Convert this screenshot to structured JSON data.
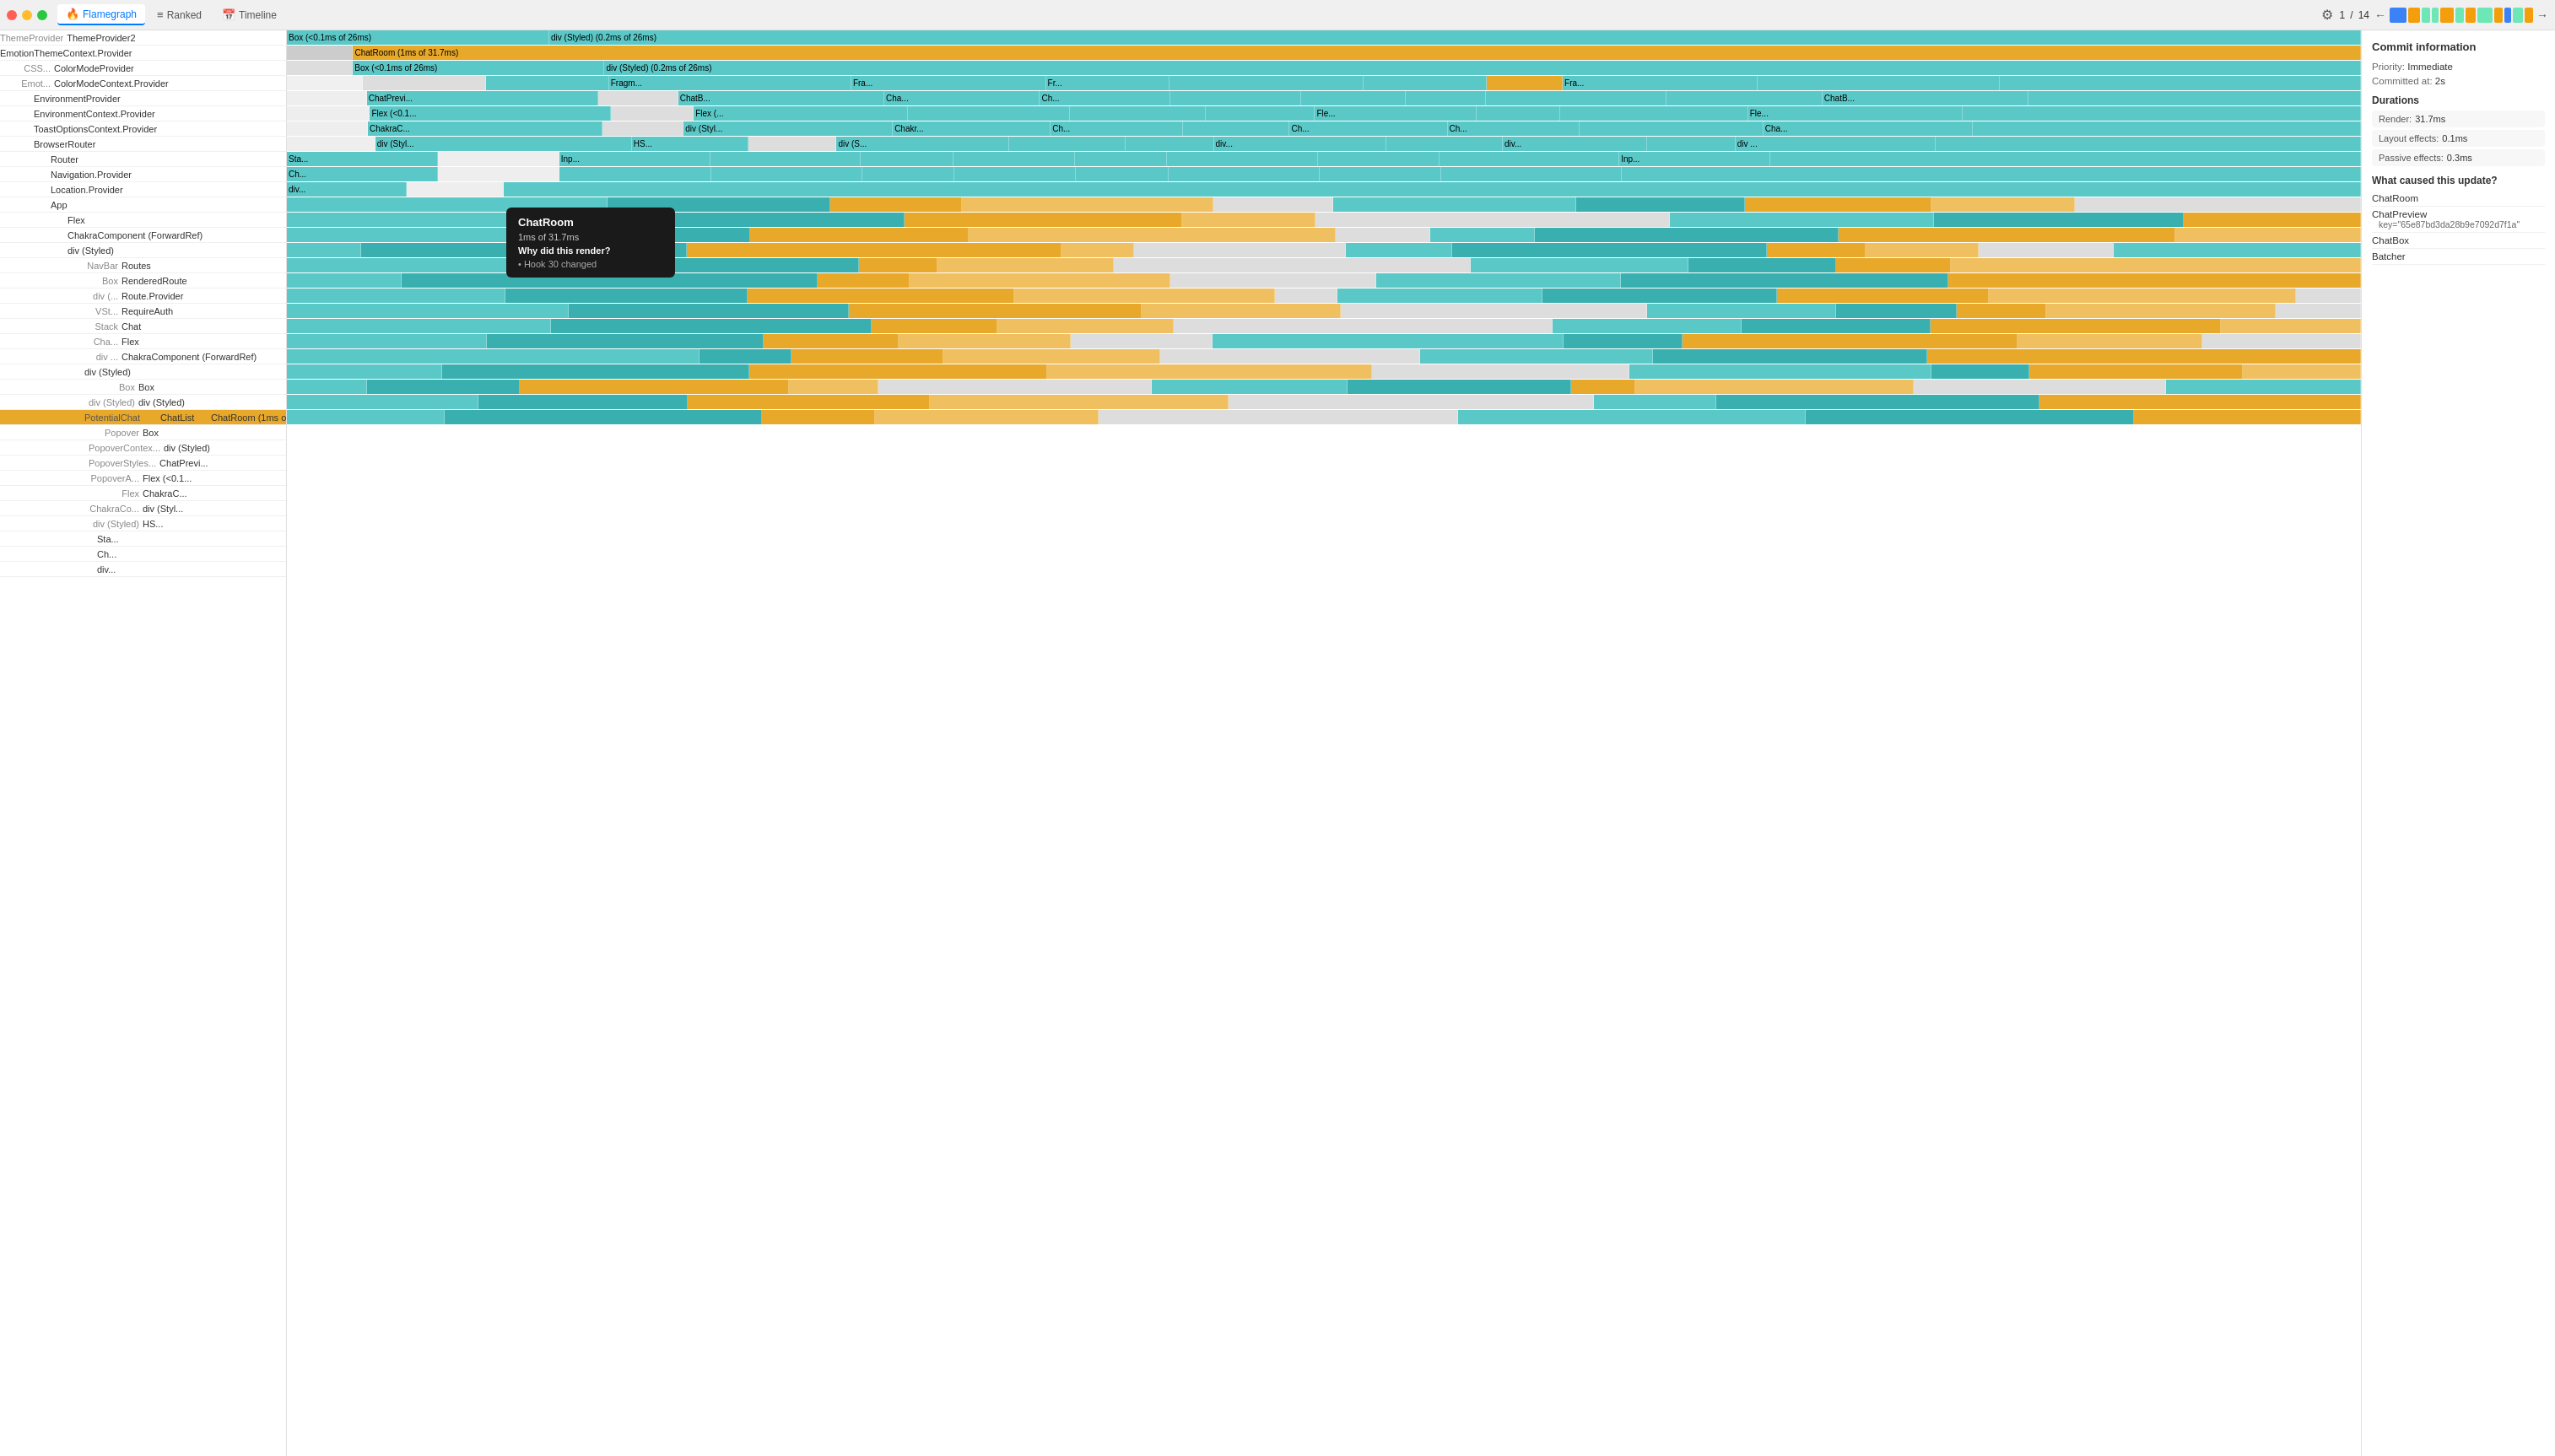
{
  "topbar": {
    "tabs": [
      {
        "id": "flamegraph",
        "label": "Flamegraph",
        "icon": "🔥",
        "active": true
      },
      {
        "id": "ranked",
        "label": "Ranked",
        "icon": "≡",
        "active": false
      },
      {
        "id": "timeline",
        "label": "Timeline",
        "icon": "📅",
        "active": false
      }
    ],
    "current_commit": "1",
    "total_commits": "14",
    "gear_icon": "⚙",
    "nav_prev": "←",
    "nav_next": "→",
    "commit_blocks": [
      {
        "color": "#3b82f6",
        "width": 20
      },
      {
        "color": "#f59e0b",
        "width": 14
      },
      {
        "color": "#6ee7b7",
        "width": 10
      },
      {
        "color": "#6ee7b7",
        "width": 8
      },
      {
        "color": "#f59e0b",
        "width": 16
      },
      {
        "color": "#6ee7b7",
        "width": 10
      },
      {
        "color": "#f59e0b",
        "width": 12
      },
      {
        "color": "#6ee7b7",
        "width": 18
      },
      {
        "color": "#f59e0b",
        "width": 10
      },
      {
        "color": "#3b82f6",
        "width": 8
      },
      {
        "color": "#6ee7b7",
        "width": 12
      },
      {
        "color": "#f59e0b",
        "width": 10
      }
    ]
  },
  "tree": {
    "rows": [
      {
        "indent": 0,
        "left": "ThemeProvider",
        "main": "",
        "label": "ThemeProvider2"
      },
      {
        "indent": 0,
        "left": "",
        "main": "",
        "label": "EmotionThemeContext.Provider"
      },
      {
        "indent": 0,
        "left": "CSS...",
        "main": "",
        "label": "ColorModeProvider"
      },
      {
        "indent": 0,
        "left": "Emot...",
        "main": "",
        "label": "ColorModeContext.Provider"
      },
      {
        "indent": 1,
        "left": "",
        "main": "",
        "label": "EnvironmentProvider"
      },
      {
        "indent": 1,
        "left": "",
        "main": "",
        "label": "EnvironmentContext.Provider"
      },
      {
        "indent": 1,
        "left": "",
        "main": "",
        "label": "ToastOptionsContext.Provider"
      },
      {
        "indent": 1,
        "left": "",
        "main": "",
        "label": "BrowserRouter"
      },
      {
        "indent": 2,
        "left": "",
        "main": "",
        "label": "Router"
      },
      {
        "indent": 2,
        "left": "",
        "main": "",
        "label": "Navigation.Provider"
      },
      {
        "indent": 2,
        "left": "",
        "main": "",
        "label": "Location.Provider"
      },
      {
        "indent": 2,
        "left": "",
        "main": "",
        "label": "App"
      },
      {
        "indent": 3,
        "left": "",
        "main": "",
        "label": "Flex"
      },
      {
        "indent": 3,
        "left": "",
        "main": "",
        "label": "ChakraComponent (ForwardRef)"
      },
      {
        "indent": 3,
        "left": "",
        "main": "",
        "label": "div (Styled)"
      },
      {
        "indent": 3,
        "left": "NavBar",
        "main": "Routes",
        "label": ""
      },
      {
        "indent": 3,
        "left": "Box",
        "main": "RenderedRoute",
        "label": ""
      },
      {
        "indent": 3,
        "left": "div (...",
        "main": "Route.Provider",
        "label": ""
      },
      {
        "indent": 3,
        "left": "VSt...",
        "main": "RequireAuth",
        "label": ""
      },
      {
        "indent": 3,
        "left": "Stack",
        "main": "Chat",
        "label": ""
      },
      {
        "indent": 3,
        "left": "Cha...",
        "main": "Flex",
        "label": ""
      },
      {
        "indent": 3,
        "left": "div ...",
        "main": "ChakraComponent (ForwardRef)",
        "label": ""
      },
      {
        "indent": 4,
        "left": "",
        "main": "div (Styled)",
        "label": ""
      },
      {
        "indent": 4,
        "left": "Box",
        "main": "Box",
        "label": ""
      },
      {
        "indent": 4,
        "left": "div (Styled)",
        "main": "div (Styled)",
        "label": ""
      },
      {
        "indent": 4,
        "left": "PotentialChat",
        "main": "ChatList",
        "label": "ChatRoom (1ms of 31.7ms)"
      }
    ]
  },
  "tooltip": {
    "title": "ChatRoom",
    "time": "1ms of 31.7ms",
    "why_label": "Why did this render?",
    "bullet": "Hook 30 changed"
  },
  "right_panel": {
    "title": "Commit information",
    "priority_label": "Priority:",
    "priority_value": "Immediate",
    "committed_label": "Committed at:",
    "committed_value": "2s",
    "durations_title": "Durations",
    "render_label": "Render:",
    "render_value": "31.7ms",
    "layout_label": "Layout effects:",
    "layout_value": "0.1ms",
    "passive_label": "Passive effects:",
    "passive_value": "0.3ms",
    "update_cause_title": "What caused this update?",
    "update_causes": [
      {
        "name": "ChatRoom",
        "sub": ""
      },
      {
        "name": "ChatPreview",
        "sub": "key=\"65e87bd3da28b9e7092d7f1a\""
      },
      {
        "name": "ChatBox",
        "sub": ""
      },
      {
        "name": "Batcher",
        "sub": ""
      }
    ]
  },
  "flame_rows": [
    {
      "bars": [
        {
          "label": "Box",
          "color": "#5bc8c8",
          "flex": 1
        },
        {
          "label": "div (Styled) (0.2ms of 26ms)",
          "color": "#5bc8c8",
          "flex": 8
        }
      ]
    }
  ]
}
